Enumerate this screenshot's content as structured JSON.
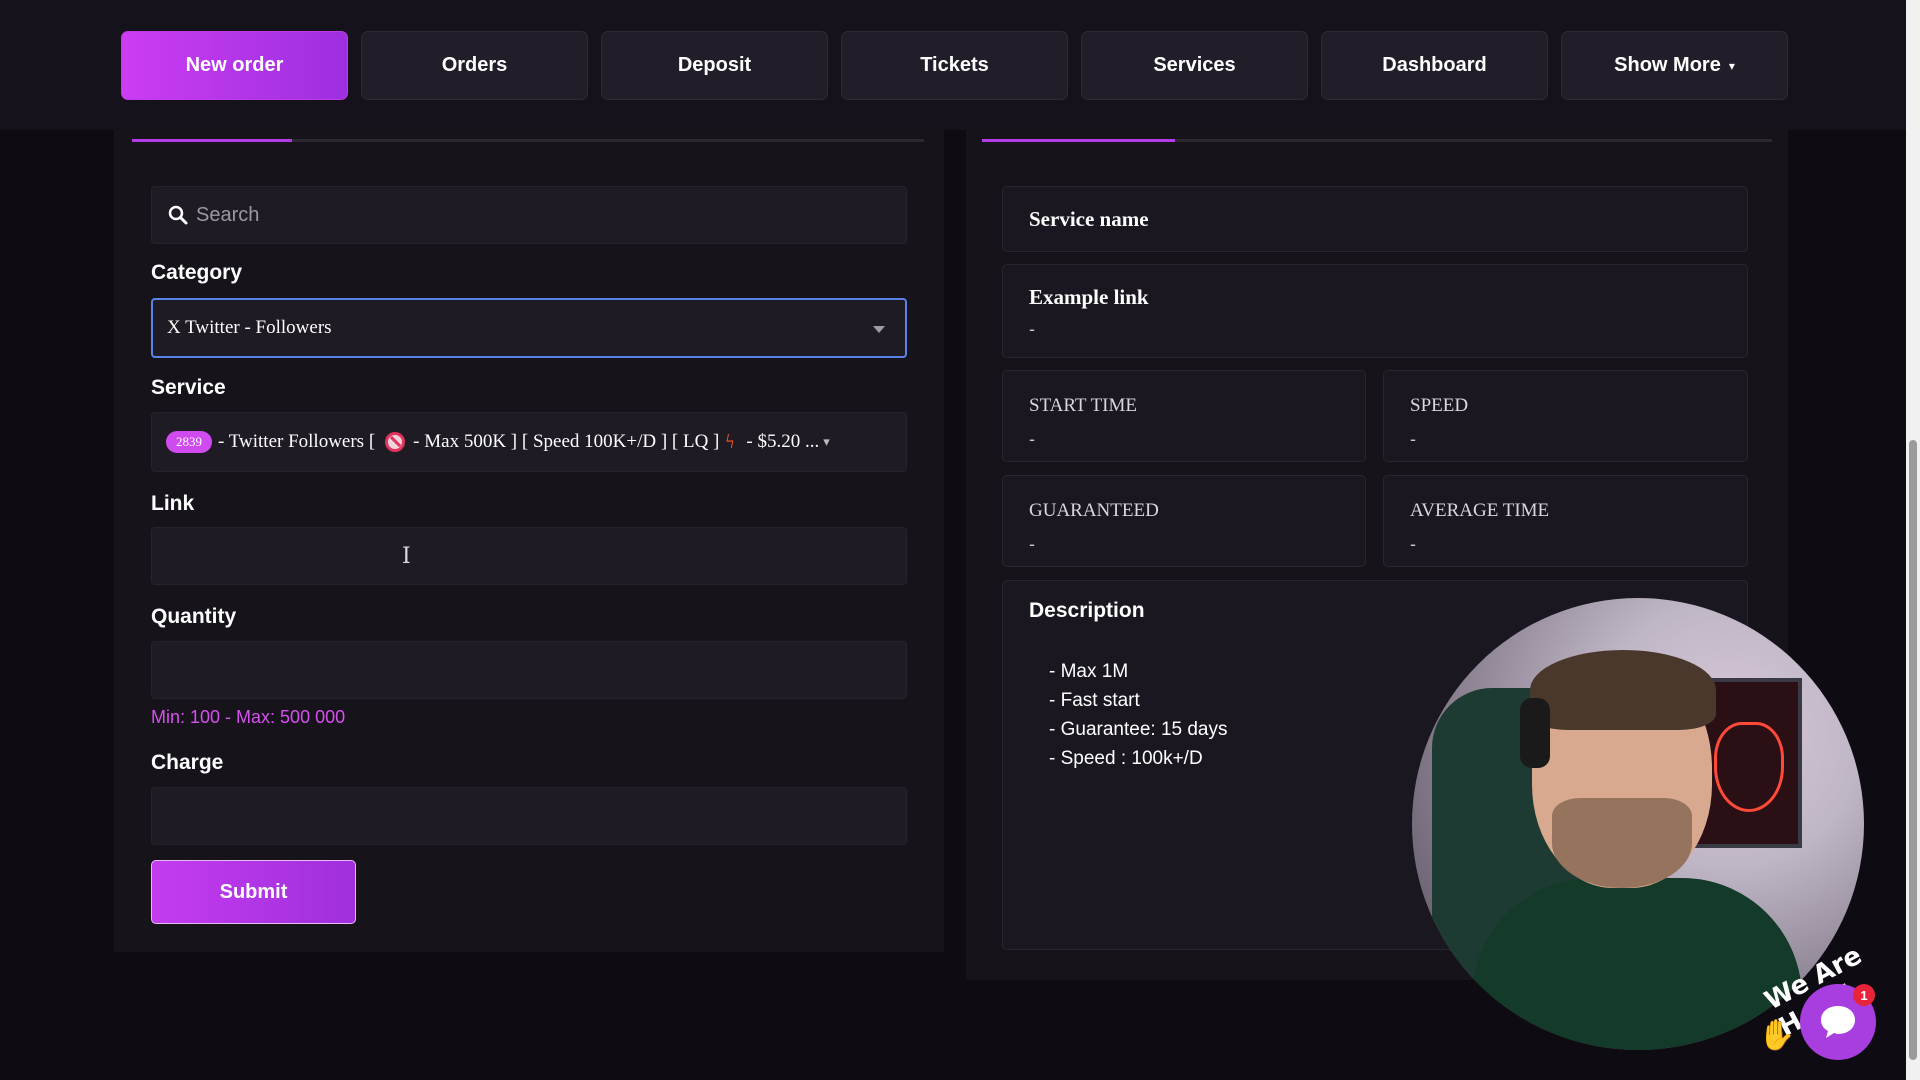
{
  "nav": {
    "items": [
      {
        "label": "New order",
        "active": true
      },
      {
        "label": "Orders",
        "active": false
      },
      {
        "label": "Deposit",
        "active": false
      },
      {
        "label": "Tickets",
        "active": false
      },
      {
        "label": "Services",
        "active": false
      },
      {
        "label": "Dashboard",
        "active": false
      },
      {
        "label": "Show More",
        "active": false,
        "has_dropdown": true
      }
    ]
  },
  "order_form": {
    "search_placeholder": "Search",
    "category_label": "Category",
    "category_value": "X Twitter - Followers",
    "service_label": "Service",
    "service": {
      "id": "2839",
      "prefix": "- Twitter Followers [",
      "middle": "- Max 500K ] [ Speed 100K+/D ] [ LQ ]",
      "price": "- $5.20 ..."
    },
    "link_label": "Link",
    "quantity_label": "Quantity",
    "quantity_hint": "Min: 100 - Max: 500 000",
    "charge_label": "Charge",
    "submit_label": "Submit"
  },
  "details": {
    "service_name_label": "Service name",
    "example_link_label": "Example link",
    "example_link_value": "-",
    "start_time_label": "START TIME",
    "start_time_value": "-",
    "speed_label": "SPEED",
    "speed_value": "-",
    "guaranteed_label": "GUARANTEED",
    "guaranteed_value": "-",
    "average_time_label": "AVERAGE TIME",
    "average_time_value": "-",
    "description_label": "Description",
    "description_items": [
      "- Max 1M",
      "- Fast start",
      "- Guarantee: 15 days",
      "- Speed : 100k+/D"
    ]
  },
  "chat": {
    "badge_count": "1",
    "greeting": "We Are Here!"
  },
  "colors": {
    "accent": "#c43cef",
    "hint": "#d84ff0",
    "background": "#0e0b12"
  }
}
